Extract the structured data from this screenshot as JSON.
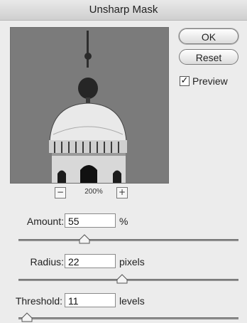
{
  "window": {
    "title": "Unsharp Mask"
  },
  "preview": {
    "zoom_out": "−",
    "zoom_label": "200%",
    "zoom_in": "+"
  },
  "buttons": {
    "ok": "OK",
    "reset": "Reset"
  },
  "preview_toggle": {
    "label": "Preview",
    "checked": true,
    "checkmark": "✓"
  },
  "fields": [
    {
      "label": "Amount:",
      "value": "55",
      "unit": "%",
      "slider_fraction": 0.3
    },
    {
      "label": "Radius:",
      "value": "22",
      "unit": "pixels",
      "slider_fraction": 0.47
    },
    {
      "label": "Threshold:",
      "value": "11",
      "unit": "levels",
      "slider_fraction": 0.04
    }
  ],
  "colors": {
    "window_bg": "#ececec",
    "preview_bg": "#7a7a7a"
  }
}
